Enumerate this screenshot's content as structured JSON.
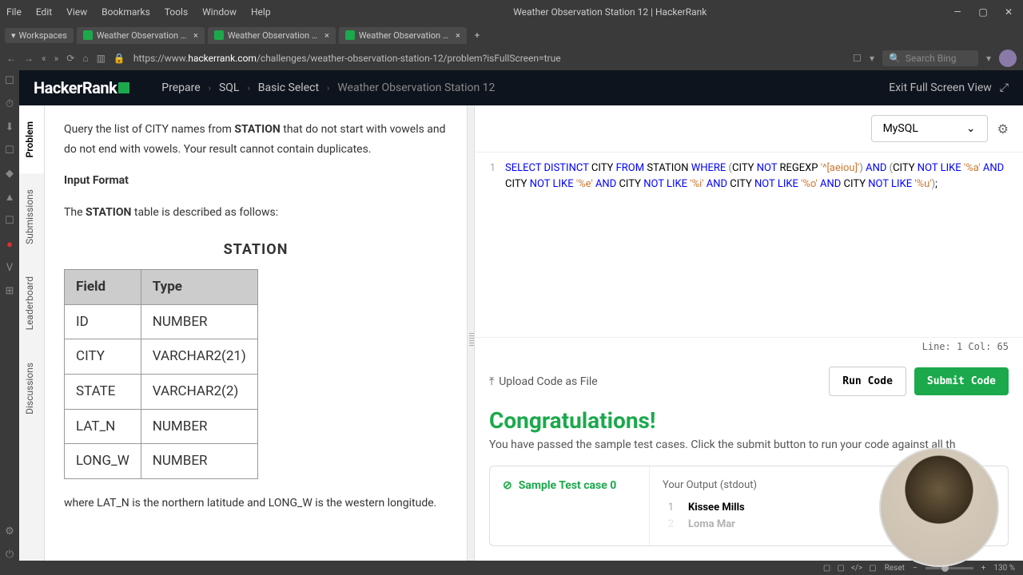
{
  "titlebar": {
    "menus": [
      "File",
      "Edit",
      "View",
      "Bookmarks",
      "Tools",
      "Window",
      "Help"
    ],
    "title": "Weather Observation Station 12 | HackerRank",
    "min": "—",
    "max": "▢",
    "close": "✕"
  },
  "tabbar": {
    "workspaces": "Workspaces",
    "tabs": [
      {
        "title": "Weather Observation Stati"
      },
      {
        "title": "Weather Observation Stati"
      },
      {
        "title": "Weather Observation Stati"
      }
    ],
    "add": "+"
  },
  "urlbar": {
    "back": "←",
    "fwd": "→",
    "dbl_back": "«",
    "dbl_fwd": "»",
    "reload": "⟳",
    "home": "⌂",
    "tabs_icon": "▥",
    "lock": "🔒",
    "url_pre": "https://www.",
    "url_domain": "hackerrank.com",
    "url_path": "/challenges/weather-observation-station-12/problem?isFullScreen=true",
    "bookmark": "☐",
    "search_icon": "🔍",
    "search_placeholder": "Search Bing",
    "chev": "▾"
  },
  "browser_sidebar": [
    "☐",
    "⏱",
    "⬇",
    "☐",
    "◆",
    "▲",
    "☐",
    "●",
    "V",
    "⊞"
  ],
  "browser_sidebar_bottom": [
    "⚙",
    "⏻"
  ],
  "header": {
    "logo": "HackerRank",
    "crumbs": [
      "Prepare",
      "SQL",
      "Basic Select",
      "Weather Observation Station 12"
    ],
    "sep": "›",
    "exit": "Exit Full Screen View",
    "exit_icon": "⤢"
  },
  "vtabs": [
    "Problem",
    "Submissions",
    "Leaderboard",
    "Discussions"
  ],
  "problem": {
    "para1_a": "Query the list of CITY names from ",
    "para1_b": "STATION",
    "para1_c": " that do not start with vowels and do not end with vowels. Your result cannot contain duplicates.",
    "input_format": "Input Format",
    "para2_a": "The ",
    "para2_b": "STATION",
    "para2_c": " table is described as follows:",
    "table_title": "STATION",
    "th1": "Field",
    "th2": "Type",
    "rows": [
      {
        "f": "ID",
        "t": "NUMBER"
      },
      {
        "f": "CITY",
        "t": "VARCHAR2(21)"
      },
      {
        "f": "STATE",
        "t": "VARCHAR2(2)"
      },
      {
        "f": "LAT_N",
        "t": "NUMBER"
      },
      {
        "f": "LONG_W",
        "t": "NUMBER"
      }
    ],
    "para3": "where LAT_N is the northern latitude and LONG_W is the western longitude."
  },
  "editor": {
    "lang": "MySQL",
    "chev": "⌄",
    "gear": "⚙",
    "line_no": "1",
    "code_tokens": [
      {
        "t": "SELECT",
        "c": "kw"
      },
      {
        "t": " "
      },
      {
        "t": "DISTINCT",
        "c": "kw"
      },
      {
        "t": " CITY "
      },
      {
        "t": "FROM",
        "c": "kw"
      },
      {
        "t": " STATION "
      },
      {
        "t": "WHERE",
        "c": "kw"
      },
      {
        "t": " "
      },
      {
        "t": "(",
        "c": "paren"
      },
      {
        "t": "CITY "
      },
      {
        "t": "NOT",
        "c": "kw"
      },
      {
        "t": " REGEXP "
      },
      {
        "t": "'^[aeiou]'",
        "c": "str"
      },
      {
        "t": ")",
        "c": "paren"
      },
      {
        "t": " "
      },
      {
        "t": "AND",
        "c": "kw"
      },
      {
        "t": " "
      },
      {
        "t": "(",
        "c": "paren"
      },
      {
        "t": "CITY "
      },
      {
        "t": "NOT",
        "c": "kw"
      },
      {
        "t": " "
      },
      {
        "t": "LIKE",
        "c": "kw"
      },
      {
        "t": " "
      },
      {
        "t": "'%a'",
        "c": "str"
      },
      {
        "t": " "
      },
      {
        "t": "AND",
        "c": "kw"
      },
      {
        "t": " CITY "
      },
      {
        "t": "NOT",
        "c": "kw"
      },
      {
        "t": " "
      },
      {
        "t": "LIKE",
        "c": "kw"
      },
      {
        "t": " "
      },
      {
        "t": "'%e'",
        "c": "str"
      },
      {
        "t": " "
      },
      {
        "t": "AND",
        "c": "kw"
      },
      {
        "t": " CITY "
      },
      {
        "t": "NOT",
        "c": "kw"
      },
      {
        "t": " "
      },
      {
        "t": "LIKE",
        "c": "kw"
      },
      {
        "t": " "
      },
      {
        "t": "'%i'",
        "c": "str"
      },
      {
        "t": " "
      },
      {
        "t": "AND",
        "c": "kw"
      },
      {
        "t": " CITY "
      },
      {
        "t": "NOT",
        "c": "kw"
      },
      {
        "t": " "
      },
      {
        "t": "LIKE",
        "c": "kw"
      },
      {
        "t": " "
      },
      {
        "t": "'%o'",
        "c": "str"
      },
      {
        "t": " "
      },
      {
        "t": "AND",
        "c": "kw"
      },
      {
        "t": " CITY "
      },
      {
        "t": "NOT",
        "c": "kw"
      },
      {
        "t": " "
      },
      {
        "t": "LIKE",
        "c": "kw"
      },
      {
        "t": " "
      },
      {
        "t": "'%u'",
        "c": "str"
      },
      {
        "t": ")",
        "c": "paren"
      },
      {
        "t": ";"
      }
    ],
    "status": "Line: 1 Col: 65",
    "upload_icon": "⤒",
    "upload": "Upload Code as File",
    "run": "Run Code",
    "submit": "Submit Code"
  },
  "result": {
    "congrats": "Congratulations!",
    "sub": "You have passed the sample test cases. Click the submit button to run your code against all th",
    "check": "⊘",
    "tc_title": "Sample Test case 0",
    "your_output": "Your Output (stdout)",
    "outputs": [
      {
        "n": "1",
        "v": "Kissee Mills"
      },
      {
        "n": "2",
        "v": "Loma Mar"
      }
    ]
  },
  "bottom": {
    "icons": [
      "▢",
      "▢",
      "</>",
      "▢"
    ],
    "reset": "Reset",
    "zoom": "130 %"
  }
}
